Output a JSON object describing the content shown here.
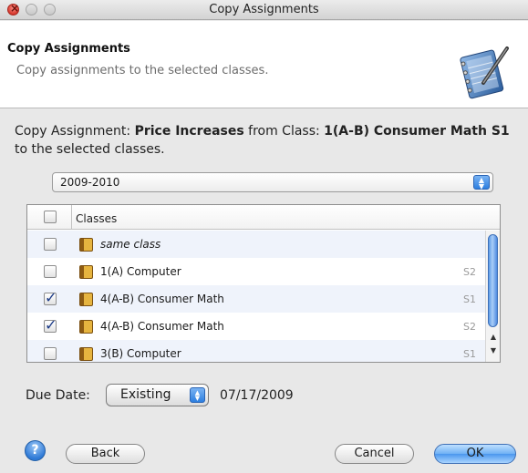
{
  "window": {
    "title": "Copy Assignments"
  },
  "header": {
    "title": "Copy Assignments",
    "subtitle": "Copy assignments to the selected classes.",
    "art_icon": "notebook-pen-icon"
  },
  "description": {
    "prefix": "Copy Assignment: ",
    "assignment": "Price Increases",
    "middle": " from Class: ",
    "class_name": "1(A-B) Consumer Math S1",
    "suffix": " to the selected classes."
  },
  "school_year": {
    "selected": "2009-2010"
  },
  "table": {
    "header_label": "Classes",
    "header_checked": false,
    "rows": [
      {
        "checked": false,
        "label": "same class",
        "term": "",
        "italic": true
      },
      {
        "checked": false,
        "label": "1(A) Computer",
        "term": "S2",
        "italic": false
      },
      {
        "checked": true,
        "label": "4(A-B) Consumer Math",
        "term": "S1",
        "italic": false
      },
      {
        "checked": true,
        "label": "4(A-B) Consumer Math",
        "term": "S2",
        "italic": false
      },
      {
        "checked": false,
        "label": "3(B) Computer",
        "term": "S1",
        "italic": false
      }
    ]
  },
  "due_date": {
    "label": "Due Date:",
    "mode": "Existing",
    "date": "07/17/2009"
  },
  "buttons": {
    "help": "?",
    "back": "Back",
    "cancel": "Cancel",
    "ok": "OK"
  }
}
